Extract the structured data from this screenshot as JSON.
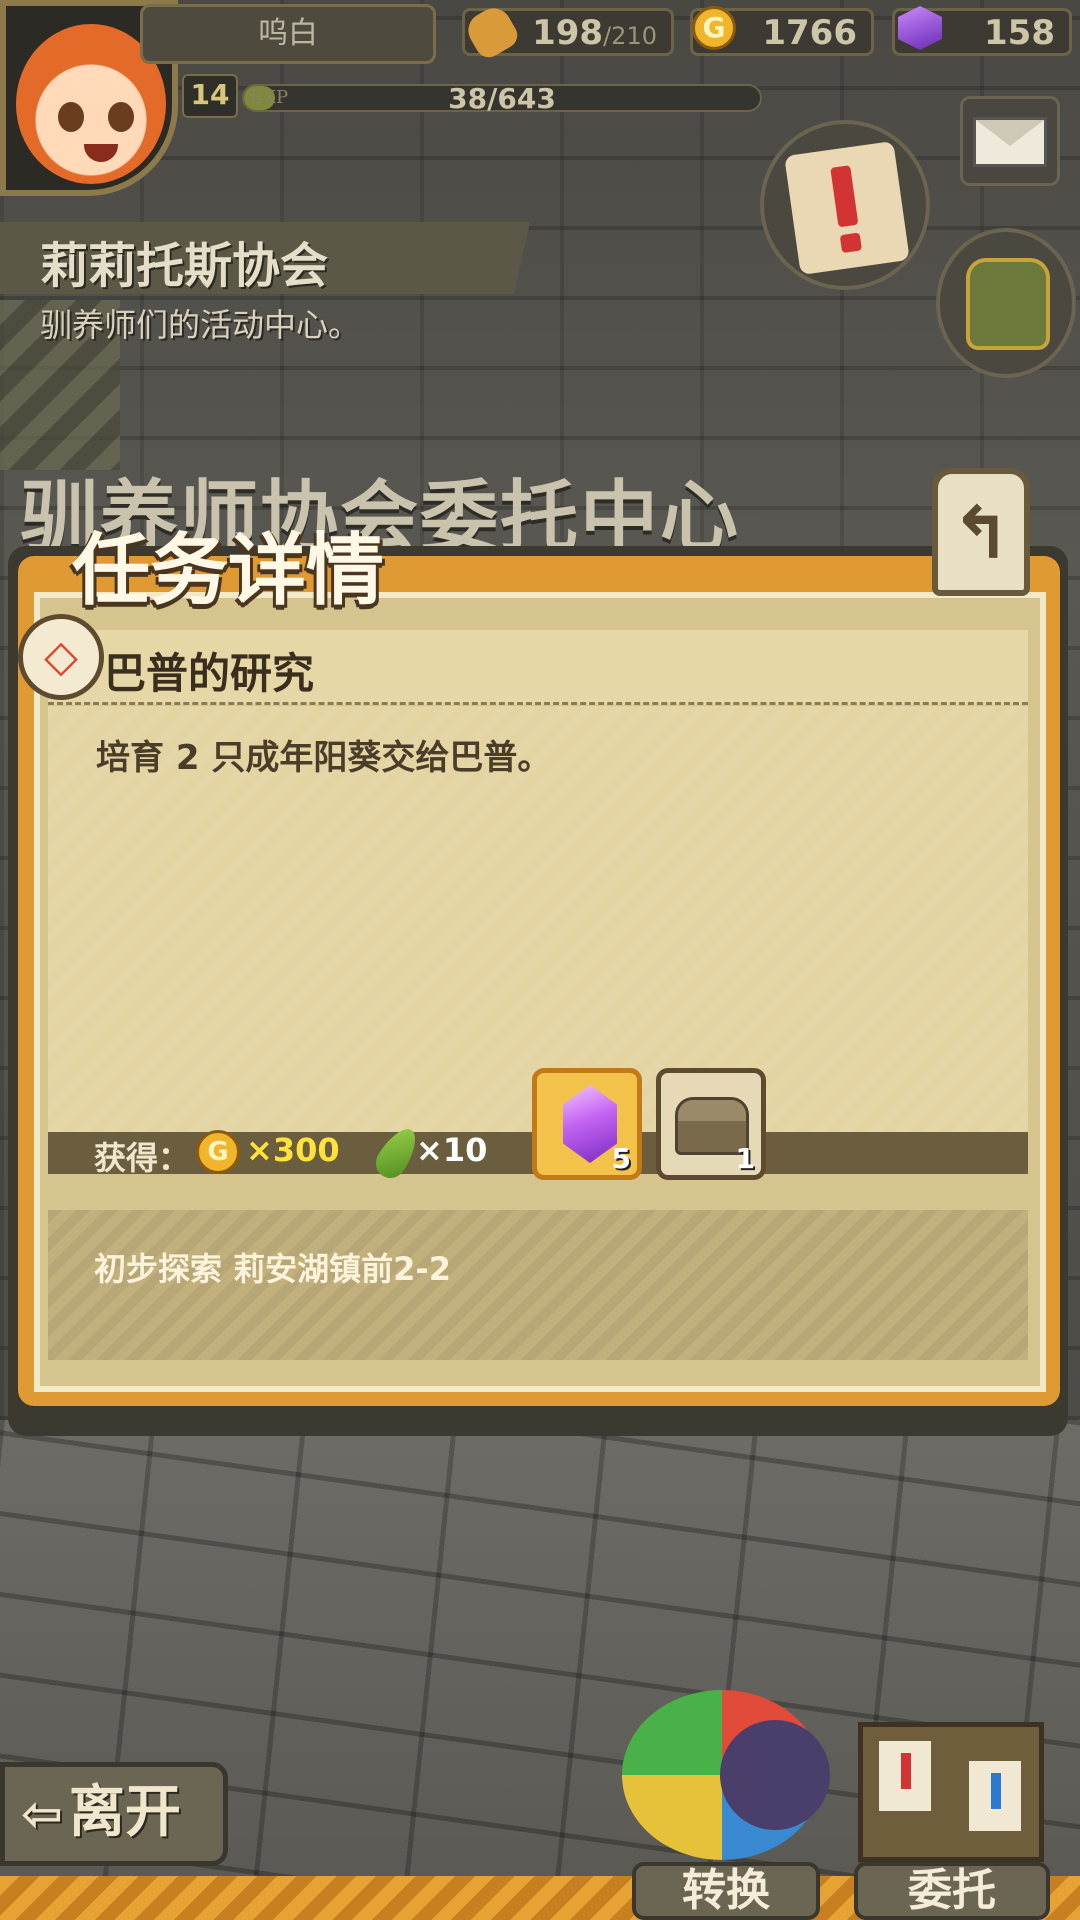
{
  "player": {
    "name": "呜白",
    "level": "14",
    "exp_label": "EXP",
    "exp_value": "38/643",
    "exp_fraction": 0.06
  },
  "resources": {
    "stamina": {
      "icon": "bread-icon",
      "current": "198",
      "max": "/210"
    },
    "gold": {
      "icon": "gold-coin-icon",
      "symbol": "G",
      "amount": "1766"
    },
    "gems": {
      "icon": "purple-gem-icon",
      "amount": "158"
    }
  },
  "location": {
    "title": "莉莉托斯协会",
    "subtitle": "驯养师们的活动中心。",
    "background_sign": "驯养师协会委托中心"
  },
  "dialog": {
    "title": "任务详情",
    "back_icon": "return-arrow-icon",
    "back_glyph": "↰",
    "quest_icon_glyph": "◇",
    "quest_name": "巴普的研究",
    "quest_description": "培育 2 只成年阳葵交给巴普。",
    "reward_label": "获得：",
    "rewards": {
      "coin_symbol": "G",
      "coin_amount": "×300",
      "feather_amount": "×10",
      "gem_count": "5",
      "chest_count": "1"
    },
    "quest_location": "初步探索 莉安湖镇前2-2"
  },
  "bottom": {
    "leave_arrow": "⇦",
    "leave_label": "离开",
    "switch_label": "转换",
    "commission_label": "委托"
  },
  "colors": {
    "dialog_orange": "#e09a33",
    "paper": "#e4d4a2",
    "gold_text": "#ffe23a",
    "bottom_stripe": "#e6a333"
  }
}
